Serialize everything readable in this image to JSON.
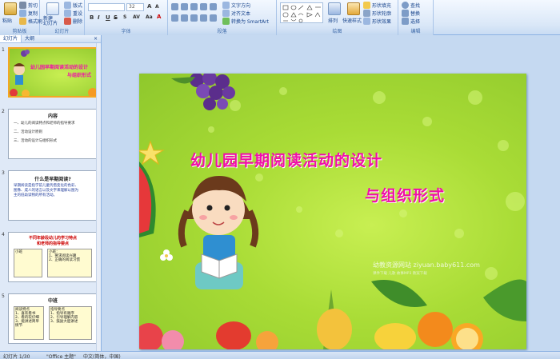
{
  "ribbon": {
    "clipboard": {
      "label": "剪贴板",
      "paste": "粘贴",
      "cut": "剪切",
      "copy": "复制",
      "format_painter": "格式刷"
    },
    "slides": {
      "label": "幻灯片",
      "new_slide": "新建\n幻灯片",
      "layout": "版式",
      "reset": "重设",
      "delete": "删除"
    },
    "font": {
      "label": "字体",
      "size": "32"
    },
    "paragraph": {
      "label": "段落",
      "text_direction": "文字方向",
      "align_text": "对齐文本",
      "smartart": "转换为 SmartArt"
    },
    "drawing": {
      "label": "绘图",
      "arrange": "排列",
      "quick_styles": "快速样式",
      "shape_fill": "形状填充",
      "shape_outline": "形状轮廓",
      "shape_effects": "形状效果"
    },
    "editing": {
      "label": "编辑",
      "find": "查找",
      "replace": "替换",
      "select": "选择"
    }
  },
  "panel": {
    "tabs": [
      "幻灯片",
      "大纲"
    ],
    "close": "×",
    "thumbs": [
      {
        "num": "1",
        "title_a": "幼儿园早期阅读活动的设计",
        "title_b": "与组织形式"
      },
      {
        "num": "2",
        "title": "内容",
        "lines": [
          "一、幼儿的阅读特点和老师的指导要求",
          "二、活动设计原则",
          "三、活动的设计与组织形式"
        ]
      },
      {
        "num": "3",
        "title": "什么是早期阅读?",
        "lines": [
          "早期阅读是指学前儿童凭借变化的色彩、",
          "图像、成人的语言以及文字来理解以图为",
          "主的低幼读物的所有活动。"
        ]
      },
      {
        "num": "4",
        "title": "不同年龄段幼儿的学习特点",
        "subtitle": "和老师的指导要点",
        "box_left": [
          "小班"
        ],
        "box_right": [
          "小班：",
          "1、要求阅读兴趣",
          "2、正确的阅读习惯"
        ]
      },
      {
        "num": "5",
        "title": "中班",
        "box_left": [
          "阅读特点",
          "1、喜欢看书",
          "2、看的较仔细",
          "3、能讲述简单情节"
        ],
        "box_right": [
          "指导要点",
          "1、指导有顺序",
          "2、引导理解内容",
          "3、鼓励大胆讲述"
        ]
      }
    ]
  },
  "slide": {
    "title_line1": "幼儿园早期阅读活动的设计",
    "title_line2": "与组织形式",
    "watermark": "幼教资源网站 ziyuan.baby611.com",
    "watermark_sub": "课件下载 儿歌 故事MP3 教案下载"
  },
  "status": {
    "slide_counter": "幻灯片 1/30",
    "theme": "\"Office 主题\"",
    "language": "中文(简体，中国)"
  },
  "colors": {
    "title_pink": "#f00fa8",
    "slide_green": "#a9dc36",
    "ribbon_blue": "#dbe8f8"
  }
}
